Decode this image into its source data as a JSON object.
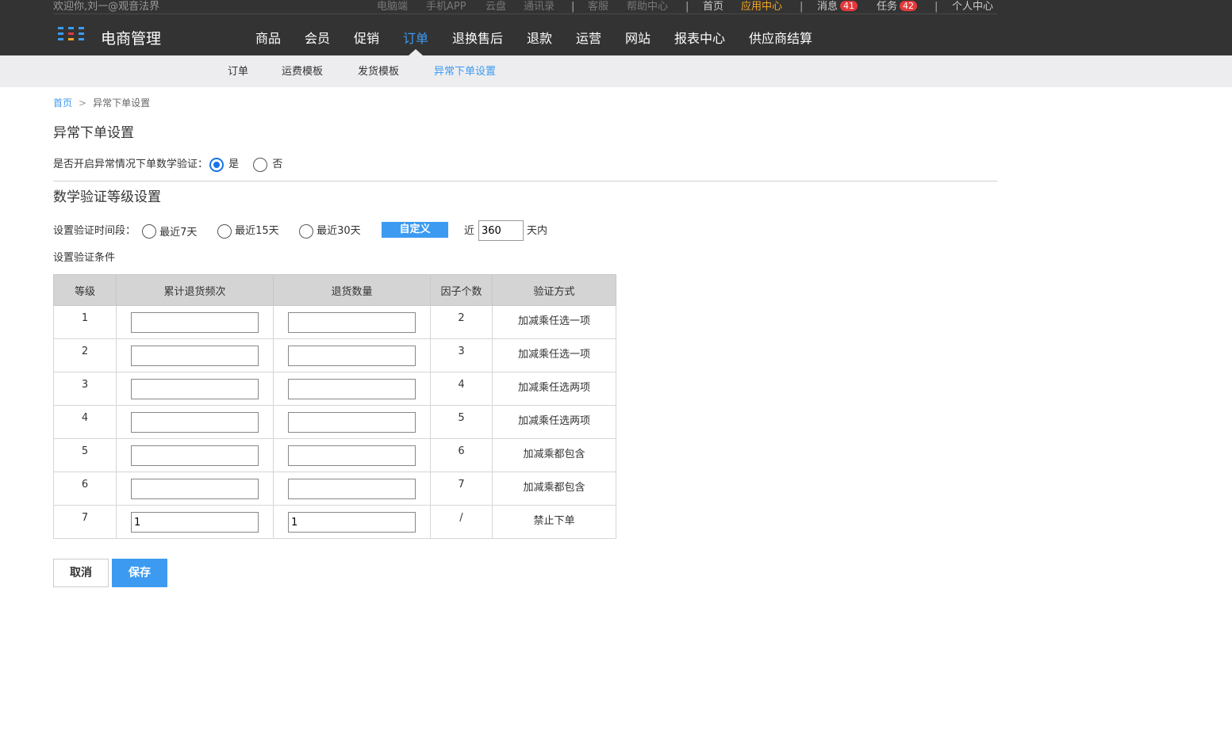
{
  "util": {
    "welcome": "欢迎你,刘一@观音法界",
    "links": [
      "电脑端",
      "手机APP",
      "云盘",
      "通讯录"
    ],
    "service": "客服",
    "help": "帮助中心",
    "home": "首页",
    "app_center": "应用中心",
    "messages": {
      "label": "消息",
      "count": "41"
    },
    "tasks": {
      "label": "任务",
      "count": "42"
    },
    "profile": "个人中心"
  },
  "brand": {
    "name": "电商管理",
    "logo_colors": [
      "#3c9bf1",
      "#3c9bf1",
      "#3c9bf1",
      "#3c9bf1",
      "#e4393c",
      "#3c9bf1",
      "#3c9bf1",
      "#f5a623",
      "#3c9bf1"
    ]
  },
  "nav": {
    "items": [
      "商品",
      "会员",
      "促销",
      "订单",
      "退换售后",
      "退款",
      "运营",
      "网站",
      "报表中心",
      "供应商结算"
    ],
    "active": "订单"
  },
  "subnav": {
    "items": [
      "订单",
      "运费模板",
      "发货模板",
      "异常下单设置"
    ],
    "active": "异常下单设置"
  },
  "breadcrumb": {
    "home": "首页",
    "sep": ">",
    "current": "异常下单设置"
  },
  "section1": {
    "title": "异常下单设置",
    "question": "是否开启异常情况下单数学验证：",
    "yes": "是",
    "no": "否",
    "selected": "是"
  },
  "section2": {
    "title": "数学验证等级设置",
    "period_label": "设置验证时间段：",
    "options": [
      "最近7天",
      "最近15天",
      "最近30天"
    ],
    "custom_button": "自定义",
    "near": "近",
    "days_value": "360",
    "days_suffix": "天内",
    "conditions_label": "设置验证条件"
  },
  "table": {
    "headers": [
      "等级",
      "累计退货频次",
      "退货数量",
      "因子个数",
      "验证方式"
    ],
    "rows": [
      {
        "level": "1",
        "freq": "",
        "qty": "",
        "factors": "2",
        "method": "加减乘任选一项"
      },
      {
        "level": "2",
        "freq": "",
        "qty": "",
        "factors": "3",
        "method": "加减乘任选一项"
      },
      {
        "level": "3",
        "freq": "",
        "qty": "",
        "factors": "4",
        "method": "加减乘任选两项"
      },
      {
        "level": "4",
        "freq": "",
        "qty": "",
        "factors": "5",
        "method": "加减乘任选两项"
      },
      {
        "level": "5",
        "freq": "",
        "qty": "",
        "factors": "6",
        "method": "加减乘都包含"
      },
      {
        "level": "6",
        "freq": "",
        "qty": "",
        "factors": "7",
        "method": "加减乘都包含"
      },
      {
        "level": "7",
        "freq": "1",
        "qty": "1",
        "factors": "/",
        "method": "禁止下单"
      }
    ]
  },
  "actions": {
    "cancel": "取消",
    "save": "保存"
  }
}
